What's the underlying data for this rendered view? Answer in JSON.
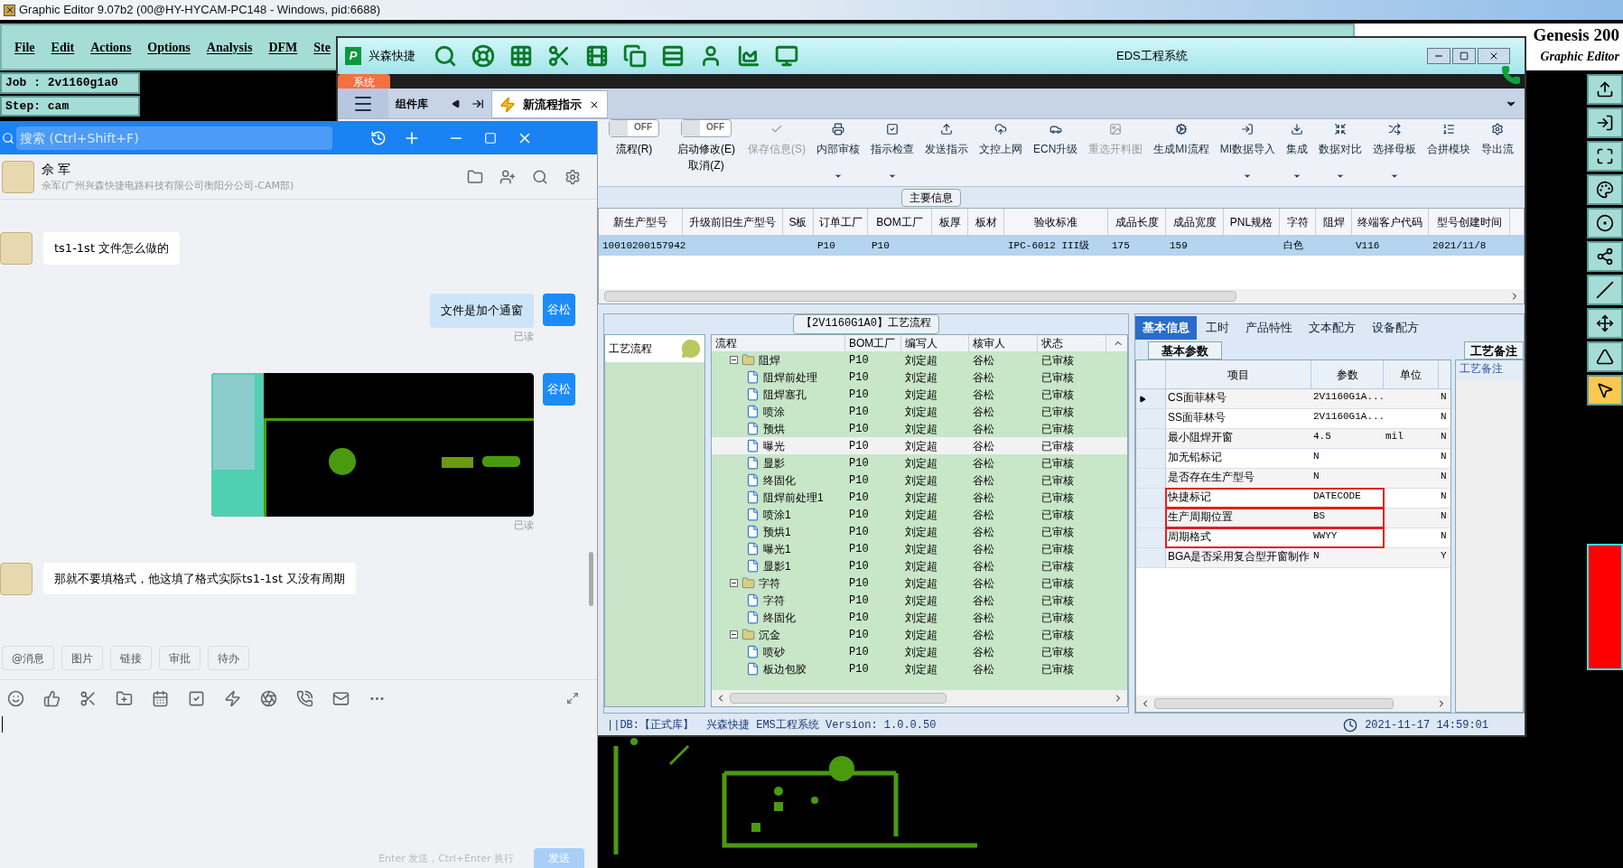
{
  "editor": {
    "title": "Graphic Editor 9.07b2 (00@HY-HYCAM-PC148 - Windows, pid:6688)",
    "menu": [
      "File",
      "Edit",
      "Actions",
      "Options",
      "Analysis",
      "DFM",
      "Ste"
    ],
    "job": "Job : 2v1160g1a0",
    "step": "Step: cam",
    "brand": "Genesis 200",
    "subtitle": "Graphic Editor",
    "tools": [
      {
        "selected": false
      },
      {
        "selected": false
      },
      {
        "selected": false
      },
      {
        "selected": false
      },
      {
        "selected": false
      },
      {
        "selected": false
      },
      {
        "selected": false
      },
      {
        "selected": false
      },
      {
        "selected": false
      },
      {
        "selected": true
      }
    ]
  },
  "eds": {
    "logo_letter": "P",
    "title": "EDS工程系统",
    "app_name": "兴森快捷",
    "system_tab": "系统",
    "side_label": "组件库",
    "doc_tab": "新流程指示",
    "toggles": [
      {
        "state_text": "OFF",
        "on": false,
        "label": "流程(R)"
      },
      {
        "state_text": "OFF",
        "on": false,
        "label": "启动修改(E)",
        "sublabel": "取消(Z)"
      }
    ],
    "actions": [
      {
        "label": "保存信息(S)",
        "disabled": true,
        "dropdown": false
      },
      {
        "label": "内部审核",
        "disabled": false,
        "dropdown": true
      },
      {
        "label": "指示检查",
        "disabled": false,
        "dropdown": true
      },
      {
        "label": "发送指示",
        "disabled": false,
        "dropdown": false
      },
      {
        "label": "文控上网",
        "disabled": false,
        "dropdown": false
      },
      {
        "label": "ECN升级",
        "disabled": false,
        "dropdown": false
      },
      {
        "label": "重选开料图",
        "disabled": true,
        "dropdown": false
      },
      {
        "label": "生成MI流程",
        "disabled": false,
        "dropdown": false
      },
      {
        "label": "MI数据导入",
        "disabled": false,
        "dropdown": true
      },
      {
        "label": "集成",
        "disabled": false,
        "dropdown": true
      },
      {
        "label": "数据对比",
        "disabled": false,
        "dropdown": true
      },
      {
        "label": "选择母板",
        "disabled": false,
        "dropdown": true
      },
      {
        "label": "合拼模块",
        "disabled": false,
        "dropdown": false
      },
      {
        "label": "导出流",
        "disabled": false,
        "dropdown": false
      }
    ],
    "main_info": {
      "title": "主要信息",
      "columns": [
        "新生产型号",
        "升级前旧生产型号",
        "S板",
        "订单工厂",
        "BOM工厂",
        "板厚",
        "板材",
        "验收标准",
        "成品长度",
        "成品宽度",
        "PNL规格",
        "字符",
        "阻焊",
        "终端客户代码",
        "型号创建时间"
      ],
      "rows": [
        {
          "selected": true,
          "cells": [
            "10010200157942",
            null,
            null,
            "P10",
            "P10",
            null,
            null,
            "IPC-6012 III级",
            "175",
            "159",
            null,
            "白色",
            null,
            "V116",
            "2021/11/8"
          ]
        }
      ]
    },
    "flow": {
      "title": "【2V1160G1A0】工艺流程",
      "list_title": "工艺流程",
      "columns": [
        "流程",
        "BOM工厂",
        "编写人",
        "核审人",
        "状态"
      ],
      "tree": [
        {
          "name": "阻焊",
          "bom": "P10",
          "writer": "刘定超",
          "reviewer": "谷松",
          "status": "已审核",
          "selected": false,
          "expanded": true,
          "children": [
            {
              "name": "阻焊前处理",
              "bom": "P10",
              "writer": "刘定超",
              "reviewer": "谷松",
              "status": "已审核",
              "selected": false
            },
            {
              "name": "阻焊塞孔",
              "bom": "P10",
              "writer": "刘定超",
              "reviewer": "谷松",
              "status": "已审核",
              "selected": false
            },
            {
              "name": "喷涂",
              "bom": "P10",
              "writer": "刘定超",
              "reviewer": "谷松",
              "status": "已审核",
              "selected": false
            },
            {
              "name": "预烘",
              "bom": "P10",
              "writer": "刘定超",
              "reviewer": "谷松",
              "status": "已审核",
              "selected": false
            },
            {
              "name": "曝光",
              "bom": "P10",
              "writer": "刘定超",
              "reviewer": "谷松",
              "status": "已审核",
              "selected": true
            },
            {
              "name": "显影",
              "bom": "P10",
              "writer": "刘定超",
              "reviewer": "谷松",
              "status": "已审核",
              "selected": false
            },
            {
              "name": "终固化",
              "bom": "P10",
              "writer": "刘定超",
              "reviewer": "谷松",
              "status": "已审核",
              "selected": false
            },
            {
              "name": "阻焊前处理1",
              "bom": "P10",
              "writer": "刘定超",
              "reviewer": "谷松",
              "status": "已审核",
              "selected": false
            },
            {
              "name": "喷涂1",
              "bom": "P10",
              "writer": "刘定超",
              "reviewer": "谷松",
              "status": "已审核",
              "selected": false
            },
            {
              "name": "预烘1",
              "bom": "P10",
              "writer": "刘定超",
              "reviewer": "谷松",
              "status": "已审核",
              "selected": false
            },
            {
              "name": "曝光1",
              "bom": "P10",
              "writer": "刘定超",
              "reviewer": "谷松",
              "status": "已审核",
              "selected": false
            },
            {
              "name": "显影1",
              "bom": "P10",
              "writer": "刘定超",
              "reviewer": "谷松",
              "status": "已审核",
              "selected": false
            }
          ]
        },
        {
          "name": "字符",
          "bom": "P10",
          "writer": "刘定超",
          "reviewer": "谷松",
          "status": "已审核",
          "selected": false,
          "expanded": true,
          "children": [
            {
              "name": "字符",
              "bom": "P10",
              "writer": "刘定超",
              "reviewer": "谷松",
              "status": "已审核",
              "selected": false
            },
            {
              "name": "终固化",
              "bom": "P10",
              "writer": "刘定超",
              "reviewer": "谷松",
              "status": "已审核",
              "selected": false
            }
          ]
        },
        {
          "name": "沉金",
          "bom": "P10",
          "writer": "刘定超",
          "reviewer": "谷松",
          "status": "已审核",
          "selected": false,
          "expanded": true,
          "children": [
            {
              "name": "喷砂",
              "bom": "P10",
              "writer": "刘定超",
              "reviewer": "谷松",
              "status": "已审核",
              "selected": false
            },
            {
              "name": "板边包胶",
              "bom": "P10",
              "writer": "刘定超",
              "reviewer": "谷松",
              "status": "已审核",
              "selected": false
            }
          ]
        }
      ]
    },
    "details": {
      "tabs": [
        {
          "label": "基本信息",
          "selected": true
        },
        {
          "label": "工时",
          "selected": false
        },
        {
          "label": "产品特性",
          "selected": false
        },
        {
          "label": "文本配方",
          "selected": false
        },
        {
          "label": "设备配方",
          "selected": false
        }
      ],
      "subtab": "基本参数",
      "columns": [
        "项目",
        "参数",
        "单位"
      ],
      "rows": [
        {
          "item": "CS面菲林号",
          "value": "2V1160G1A...",
          "unit": null,
          "column_4": "N",
          "current": true,
          "highlighted": false
        },
        {
          "item": "SS面菲林号",
          "value": "2V1160G1A...",
          "unit": null,
          "column_4": "N",
          "current": false,
          "highlighted": false
        },
        {
          "item": "最小阻焊开窗",
          "value": "4.5",
          "unit": "mil",
          "column_4": "N",
          "current": false,
          "highlighted": false
        },
        {
          "item": "加无铅标记",
          "value": "N",
          "unit": null,
          "column_4": "N",
          "current": false,
          "highlighted": false
        },
        {
          "item": "是否存在生产型号",
          "value": "N",
          "unit": null,
          "column_4": "N",
          "current": false,
          "highlighted": false
        },
        {
          "item": "快捷标记",
          "value": "DATECODE",
          "unit": null,
          "column_4": "N",
          "current": false,
          "highlighted": true
        },
        {
          "item": "生产周期位置",
          "value": "BS",
          "unit": null,
          "column_4": "N",
          "current": false,
          "highlighted": true
        },
        {
          "item": "周期格式",
          "value": "WWYY",
          "unit": null,
          "column_4": "N",
          "current": false,
          "highlighted": true
        },
        {
          "item": "BGA是否采用复合型开窗制作",
          "value": "N",
          "unit": null,
          "column_4": "Y",
          "current": false,
          "highlighted": false
        }
      ],
      "notes_title": "工艺备注",
      "notes_link": "工艺备注"
    },
    "status_bar": {
      "db": "||DB:【正式库】",
      "version": "兴森快捷 EMS工程系统 Version: 1.0.0.50",
      "time": "2021-11-17 14:59:01"
    }
  },
  "chat": {
    "search": {
      "placeholder": "搜索 (Ctrl+Shift+F)"
    },
    "contact": "佘 军",
    "contact_detail": "佘军(广州兴森快捷电路科技有限公司衡阳分公司-CAM部)",
    "messages": [
      {
        "kind": "incoming",
        "text": "ts1-1st 文件怎么做的"
      },
      {
        "kind": "outgoing",
        "text": "文件是加个通窗",
        "avatar": "谷松",
        "status": "已读"
      },
      {
        "kind": "outgoing_image",
        "avatar": "谷松",
        "status": "已读"
      },
      {
        "kind": "incoming",
        "text": "那就不要填格式，他这填了格式实际ts1-1st 又没有周期"
      }
    ],
    "chips": [
      "@消息",
      "图片",
      "链接",
      "审批",
      "待办"
    ],
    "hint": "Enter 发送，Ctrl+Enter 换行",
    "send": {
      "label": "发送",
      "disabled": true
    }
  }
}
